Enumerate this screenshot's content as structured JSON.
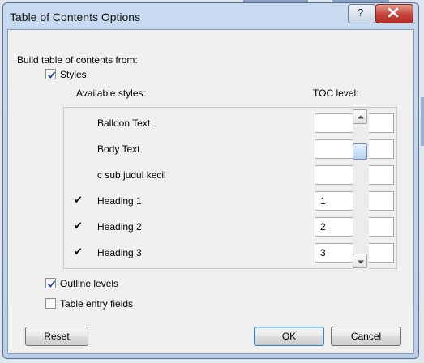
{
  "window": {
    "title": "Table of Contents Options"
  },
  "build_label": "Build table of contents from:",
  "styles_checkbox": {
    "label": "Styles",
    "checked": true
  },
  "columns": {
    "available": "Available styles:",
    "level": "TOC level:"
  },
  "styles": [
    {
      "name": "Balloon Text",
      "checked": false,
      "level": ""
    },
    {
      "name": "Body Text",
      "checked": false,
      "level": ""
    },
    {
      "name": "c sub judul kecil",
      "checked": false,
      "level": ""
    },
    {
      "name": "Heading 1",
      "checked": true,
      "level": "1"
    },
    {
      "name": "Heading 2",
      "checked": true,
      "level": "2"
    },
    {
      "name": "Heading 3",
      "checked": true,
      "level": "3"
    }
  ],
  "outline_checkbox": {
    "label": "Outline levels",
    "checked": true
  },
  "entry_checkbox": {
    "label": "Table entry fields",
    "checked": false
  },
  "buttons": {
    "reset": "Reset",
    "ok": "OK",
    "cancel": "Cancel"
  },
  "check_mark": "✔",
  "help_glyph": "?",
  "colors": {
    "close_button": "#c1433a",
    "default_button_border": "#3c7fb1"
  }
}
